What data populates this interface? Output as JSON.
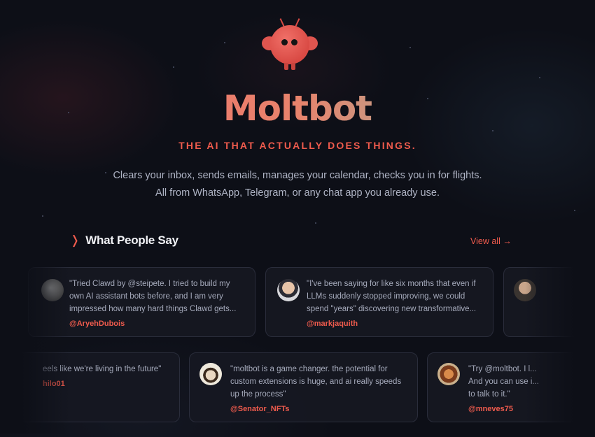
{
  "hero": {
    "title": "Moltbot",
    "tagline": "THE AI THAT ACTUALLY DOES THINGS.",
    "description_line1": "Clears your inbox, sends emails, manages your calendar, checks you in for flights.",
    "description_line2": "All from WhatsApp, Telegram, or any chat app you already use."
  },
  "testimonials": {
    "heading_chevron": "❭",
    "heading": "What People Say",
    "view_all": "View all →",
    "row1": [
      {
        "quote": "\"Tried Clawd by @steipete. I tried to build my own AI assistant bots before, and I am very impressed how many hard things Clawd gets...",
        "handle": "@AryehDubois"
      },
      {
        "quote": "\"I've been saying for like six months that even if LLMs suddenly stopped improving, we could spend \"years\" discovering new transformative...",
        "handle": "@markjaquith"
      }
    ],
    "row2": [
      {
        "quote": "eels like we're living in the future\"",
        "handle": "hilo01"
      },
      {
        "quote": "\"moltbot is a game changer. the potential for custom extensions is huge, and ai really speeds up the process\"",
        "handle": "@Senator_NFTs"
      },
      {
        "quote": "\"Try @moltbot. I l... And you can use i... to talk to it.\"",
        "handle": "@mneves75"
      }
    ]
  },
  "colors": {
    "accent": "#ef5b4d",
    "background": "#0d0f17"
  }
}
